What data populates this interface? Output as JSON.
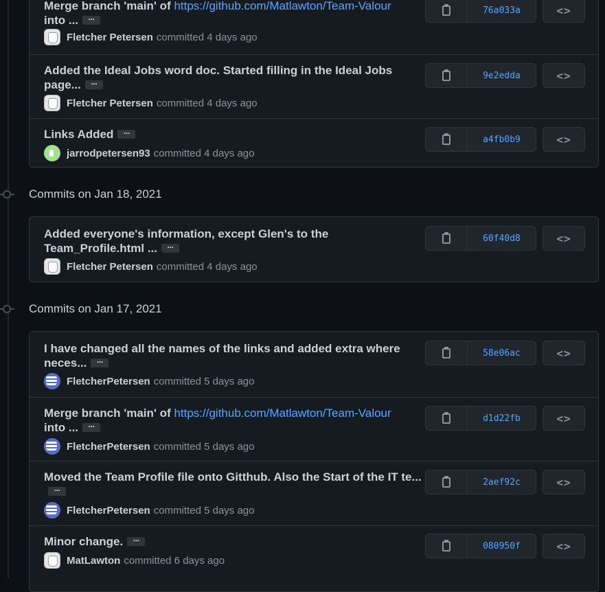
{
  "groups": [
    {
      "header": null,
      "commits": [
        {
          "title": "Merge branch 'main' of ",
          "link": "https://github.com/Matlawton/Team-Valour",
          "title2": "into ...",
          "author": "Fletcher Petersen",
          "when": "committed 4 days ago",
          "sha": "76a033a",
          "avatar": "github"
        },
        {
          "title": "Added the Ideal Jobs word doc. Started filling in the Ideal Jobs page...",
          "author": "Fletcher Petersen",
          "when": "committed 4 days ago",
          "sha": "9e2edda",
          "avatar": "github"
        },
        {
          "title": "Links Added",
          "author": "jarrodpetersen93",
          "when": "committed 4 days ago",
          "sha": "a4fb0b9",
          "avatar": "green"
        }
      ]
    },
    {
      "header": "Commits on Jan 18, 2021",
      "commits": [
        {
          "title": "Added everyone's information, except Glen's to the Team_Profile.html ...",
          "author": "Fletcher Petersen",
          "when": "committed 4 days ago",
          "sha": "60f40d8",
          "avatar": "github"
        }
      ]
    },
    {
      "header": "Commits on Jan 17, 2021",
      "commits": [
        {
          "title": "I have changed all the names of the links and added extra where neces...",
          "author": "FletcherPetersen",
          "when": "committed 5 days ago",
          "sha": "58e06ac",
          "avatar": "blue"
        },
        {
          "title": "Merge branch 'main' of ",
          "link": "https://github.com/Matlawton/Team-Valour",
          "title2": "into ...",
          "author": "FletcherPetersen",
          "when": "committed 5 days ago",
          "sha": "d1d22fb",
          "avatar": "blue"
        },
        {
          "title": "Moved the Team Profile file onto Gitthub. Also the Start of the IT te...",
          "author": "FletcherPetersen",
          "when": "committed 5 days ago",
          "sha": "2aef92c",
          "avatar": "blue"
        },
        {
          "title": "Minor change.",
          "author": "MatLawton",
          "when": "committed 6 days ago",
          "sha": "080950f",
          "avatar": "github"
        }
      ]
    }
  ]
}
